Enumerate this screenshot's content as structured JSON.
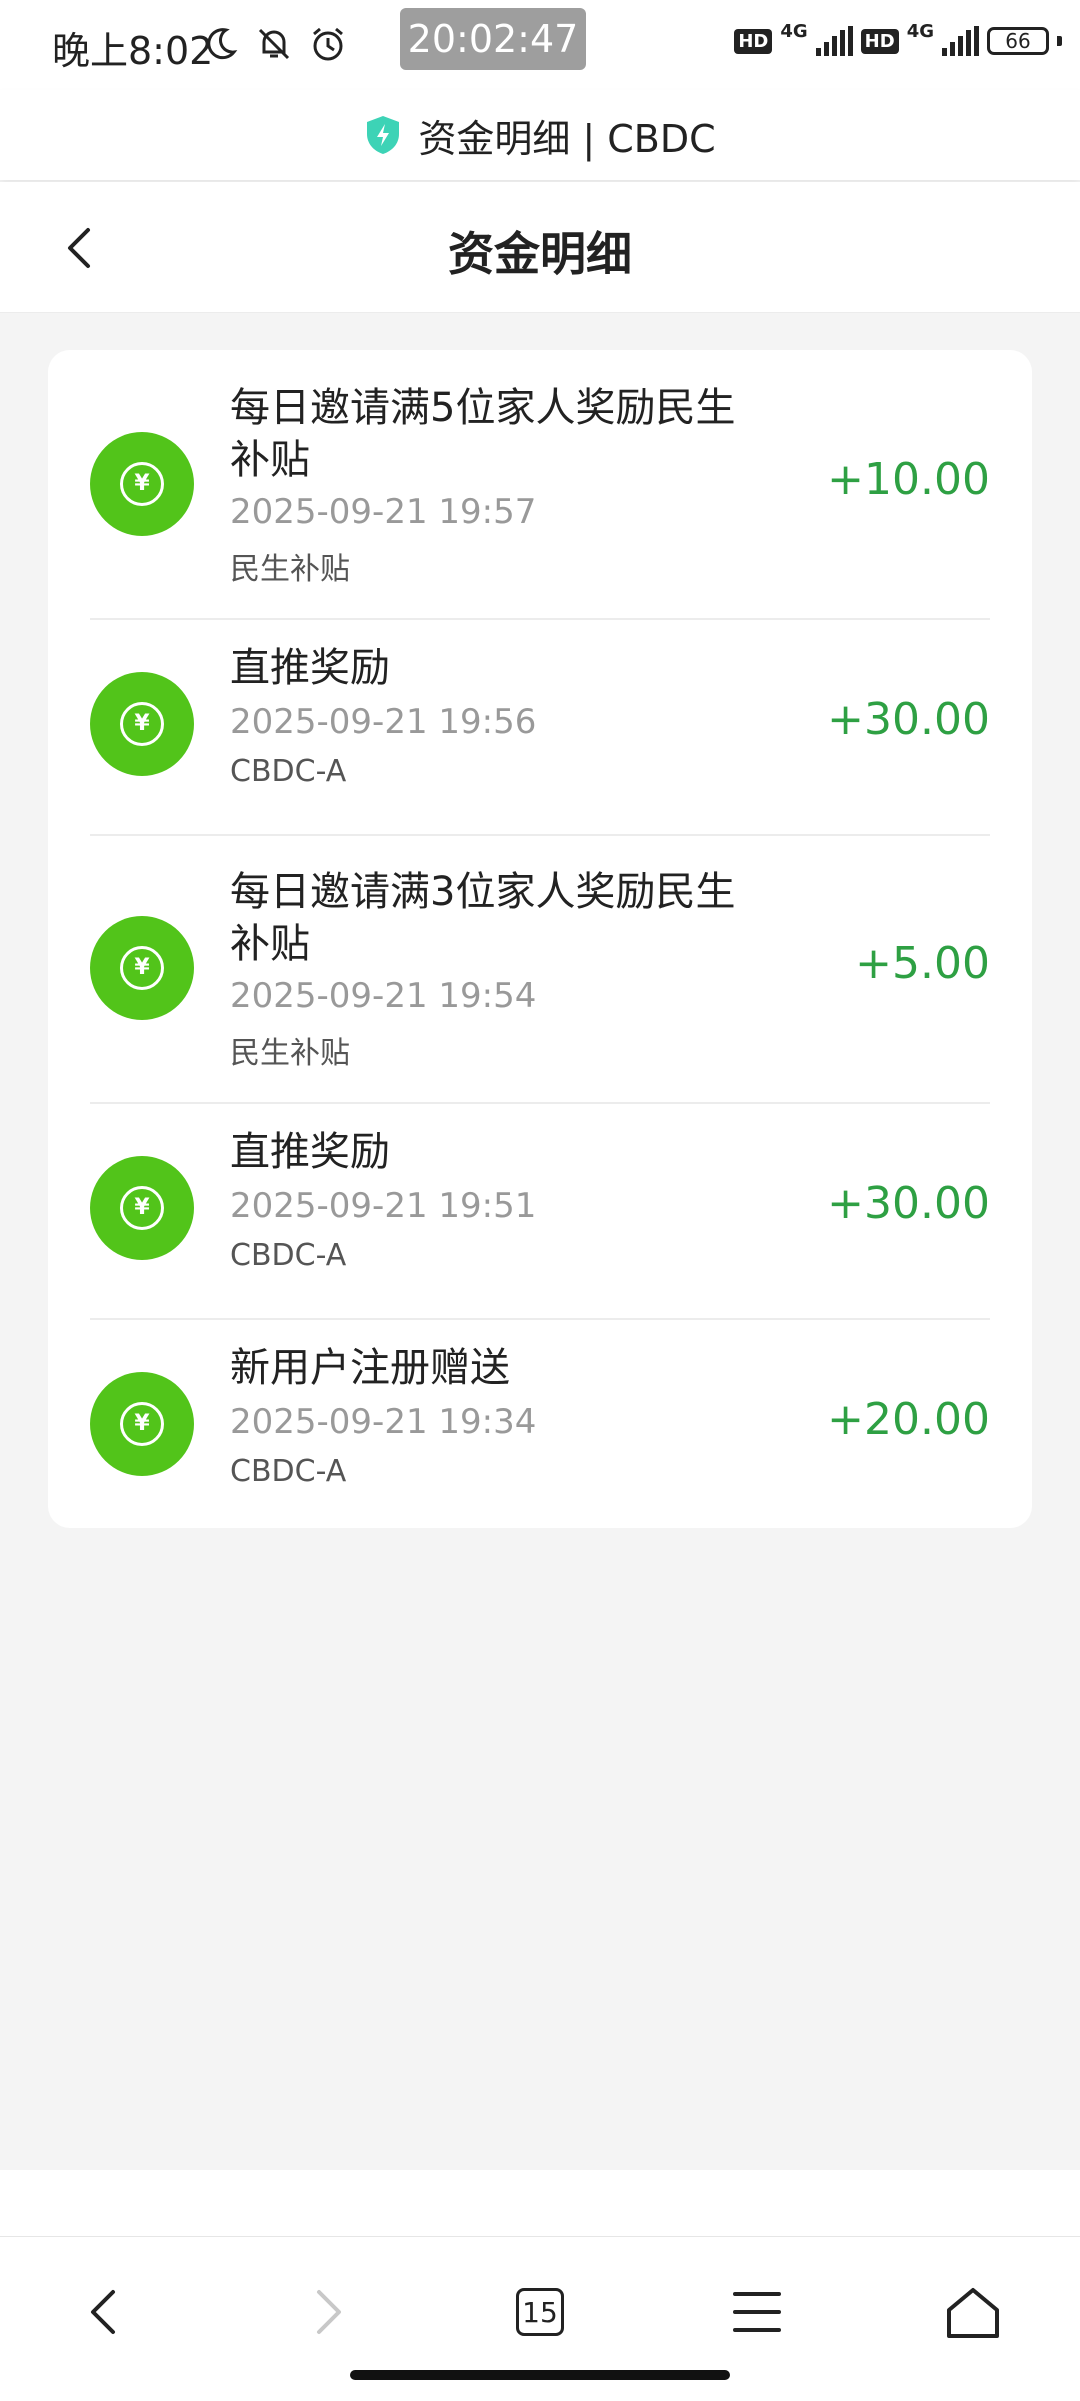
{
  "status_bar": {
    "time": "晚上8:02",
    "center_clock": "20:02:47",
    "hd_label": "HD",
    "network_label": "4G",
    "battery": "66",
    "left_icons": [
      "moon-icon",
      "bell-off-icon",
      "alarm-icon"
    ]
  },
  "browser": {
    "title": "资金明细 | CBDC",
    "shield_color": "#3dd3b6"
  },
  "header": {
    "title": "资金明细"
  },
  "colors": {
    "coin": "#52c41a",
    "amount": "#2ea043"
  },
  "transactions": [
    {
      "title": "每日邀请满5位家人奖励民生补贴",
      "time": "2025-09-21 19:57",
      "category": "民生补贴",
      "amount": "+10.00"
    },
    {
      "title": "直推奖励",
      "time": "2025-09-21 19:56",
      "category": "CBDC-A",
      "amount": "+30.00"
    },
    {
      "title": "每日邀请满3位家人奖励民生补贴",
      "time": "2025-09-21 19:54",
      "category": "民生补贴",
      "amount": "+5.00"
    },
    {
      "title": "直推奖励",
      "time": "2025-09-21 19:51",
      "category": "CBDC-A",
      "amount": "+30.00"
    },
    {
      "title": "新用户注册赠送",
      "time": "2025-09-21 19:34",
      "category": "CBDC-A",
      "amount": "+20.00"
    }
  ],
  "bottom_nav": {
    "tab_count": "15",
    "items": [
      "back-icon",
      "forward-icon",
      "tabs-icon",
      "menu-icon",
      "home-icon"
    ]
  }
}
